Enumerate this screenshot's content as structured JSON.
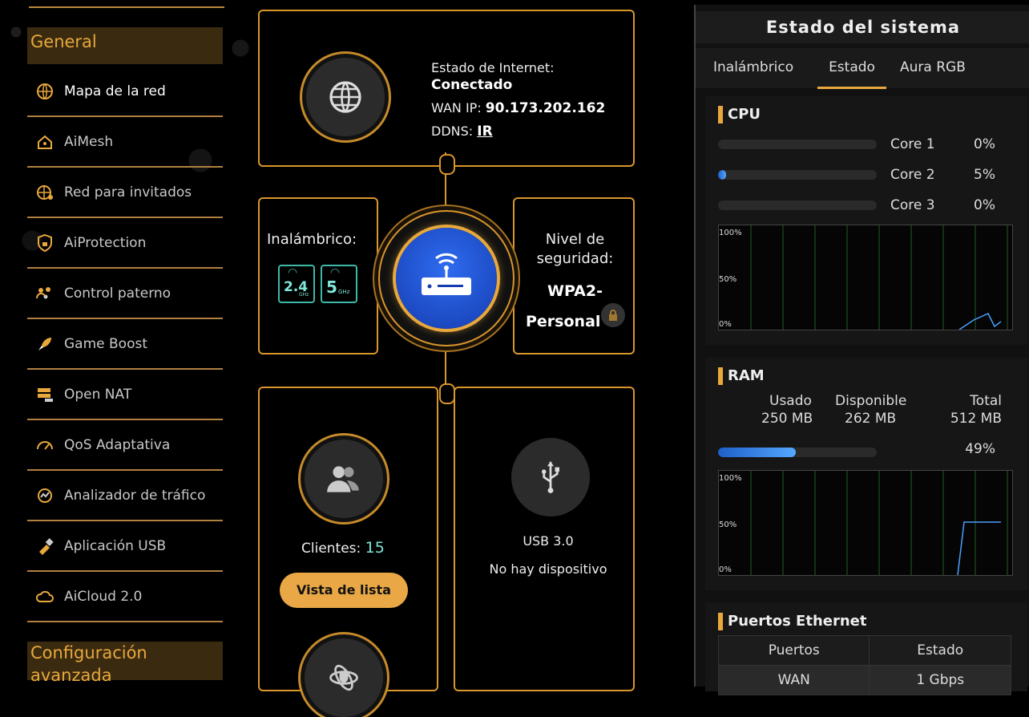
{
  "sidebar": {
    "general_header": "General",
    "advanced_header": "Configuración avanzada",
    "items": [
      {
        "label": "Mapa de la red",
        "icon": "network-map-icon",
        "active": true
      },
      {
        "label": "AiMesh",
        "icon": "aimesh-icon"
      },
      {
        "label": "Red para invitados",
        "icon": "guest-network-icon"
      },
      {
        "label": "AiProtection",
        "icon": "shield-lock-icon"
      },
      {
        "label": "Control paterno",
        "icon": "parental-control-icon"
      },
      {
        "label": "Game Boost",
        "icon": "rocket-icon"
      },
      {
        "label": "Open NAT",
        "icon": "open-nat-icon"
      },
      {
        "label": "QoS Adaptativa",
        "icon": "gauge-icon"
      },
      {
        "label": "Analizador de tráfico",
        "icon": "traffic-analyzer-icon"
      },
      {
        "label": "Aplicación USB",
        "icon": "usb-app-icon"
      },
      {
        "label": "AiCloud 2.0",
        "icon": "cloud-icon"
      }
    ]
  },
  "internet": {
    "status_label": "Estado de Internet:",
    "status_value": "Conectado",
    "wan_label": "WAN IP:",
    "wan_ip": "90.173.202.162",
    "ddns_label": "DDNS:",
    "ddns_value": "IR"
  },
  "wireless": {
    "label": "Inalámbrico:",
    "band1": "2.4",
    "band1_unit": "GHz",
    "band2": "5",
    "band2_unit": "GHz"
  },
  "security": {
    "label_line1": "Nivel de",
    "label_line2": "seguridad:",
    "value_line1": "WPA2-",
    "value_line2": "Personal"
  },
  "clients": {
    "label": "Clientes:",
    "count": "15",
    "button": "Vista de lista"
  },
  "usb": {
    "type": "USB 3.0",
    "status": "No hay dispositivo"
  },
  "system": {
    "title": "Estado del sistema",
    "tabs": [
      "Inalámbrico",
      "Estado",
      "Aura RGB"
    ],
    "active_tab": "Estado",
    "cpu": {
      "title": "CPU",
      "cores": [
        {
          "name": "Core 1",
          "value": "0%",
          "level": 0
        },
        {
          "name": "Core 2",
          "value": "5%",
          "level": 0.05
        },
        {
          "name": "Core 3",
          "value": "0%",
          "level": 0
        }
      ],
      "graph_labels": [
        "100%",
        "50%",
        "0%"
      ]
    },
    "ram": {
      "title": "RAM",
      "used_label": "Usado",
      "used_value": "250 MB",
      "free_label": "Disponible",
      "free_value": "262 MB",
      "total_label": "Total",
      "total_value": "512 MB",
      "percent": "49%",
      "level": 0.49,
      "graph_labels": [
        "100%",
        "50%",
        "0%"
      ]
    },
    "ethernet": {
      "title": "Puertos Ethernet",
      "headers": [
        "Puertos",
        "Estado"
      ],
      "rows": [
        [
          "WAN",
          "1 Gbps"
        ]
      ]
    }
  },
  "colors": {
    "accent": "#e8a83c",
    "router_blue": "#1f4fd0",
    "graph_line": "#4aa0ff"
  }
}
